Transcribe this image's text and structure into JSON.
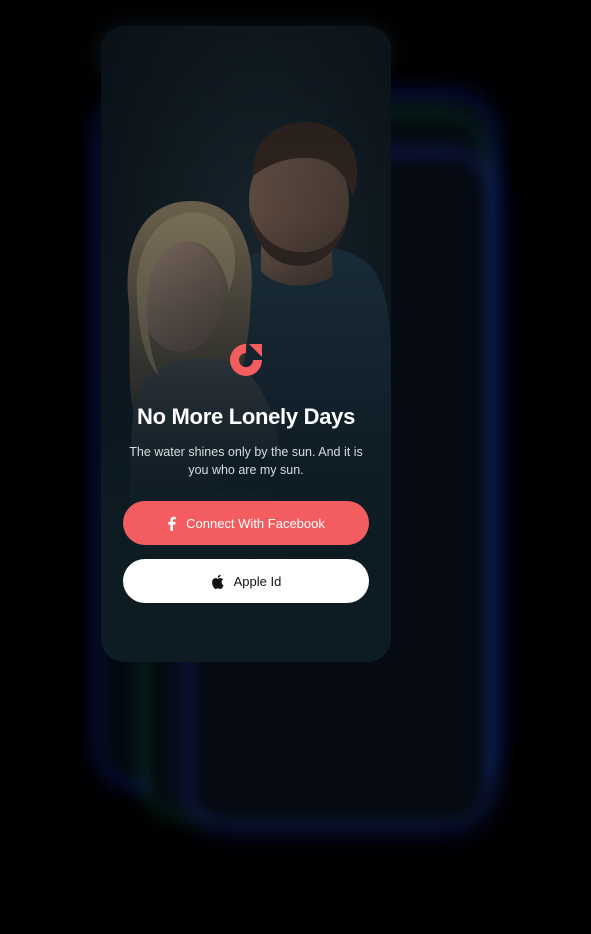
{
  "login": {
    "title": "No More Lonely Days",
    "subtitle": "The water shines only by the sun. And it is you who are my sun.",
    "facebook_button_label": "Connect With Facebook",
    "apple_button_label": "Apple Id"
  },
  "icons": {
    "logo": "app-logo-icon",
    "facebook": "facebook-icon",
    "apple": "apple-icon"
  },
  "colors": {
    "accent": "#f45d5f",
    "background": "#0d1b23",
    "button_light": "#ffffff"
  }
}
